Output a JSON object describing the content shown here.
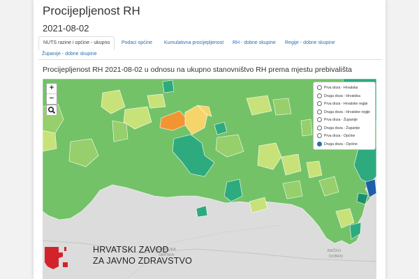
{
  "page": {
    "title": "Procijepljenost RH",
    "date": "2021-08-02",
    "subtitle": "Procijepljenost RH 2021-08-02 u odnosu na ukupno stanovništvo RH prema mjestu prebivališta"
  },
  "tabs": [
    {
      "label": "NUTS razine i općine - ukupno",
      "active": true
    },
    {
      "label": "Podaci općine"
    },
    {
      "label": "Kumulativna procijepljenost"
    },
    {
      "label": "RH - dobne skupine"
    },
    {
      "label": "Regije - dobne skupine"
    },
    {
      "label": "Županije - dobne skupine"
    }
  ],
  "map": {
    "zoom_in": "+",
    "zoom_out": "−",
    "search_icon": "magnifier-icon",
    "colors": {
      "green": "#73c268",
      "light_green": "#96cf6b",
      "yellow_green": "#c8e27a",
      "yellow": "#f5d56a",
      "orange": "#f29432",
      "teal": "#2eaa7f",
      "dark_teal": "#1b8f6e",
      "blue": "#1f5fa8",
      "background": "#dcdcdc"
    },
    "place_labels": {
      "republika": "REPUBLIKA",
      "srpska": "SRPSKA",
      "backo": "BAČKO",
      "dobro": "DOBRO"
    }
  },
  "layers": {
    "options": [
      {
        "label": "Prva doza - Hrvatska",
        "selected": false
      },
      {
        "label": "Druga doza - Hrvatska",
        "selected": false
      },
      {
        "label": "Prva doza - Hrvatske regije",
        "selected": false
      },
      {
        "label": "Druga doza - Hrvatske regije",
        "selected": false
      },
      {
        "label": "Prva doza - Županije",
        "selected": false
      },
      {
        "label": "Druga doza - Županije",
        "selected": false
      },
      {
        "label": "Prva doza - Općine",
        "selected": false
      },
      {
        "label": "Druga doza - Općine",
        "selected": true
      }
    ]
  },
  "logo": {
    "line1": "HRVATSKI ZAVOD",
    "line2": "ZA JAVNO ZDRAVSTVO",
    "accent_color": "#d2232a"
  }
}
